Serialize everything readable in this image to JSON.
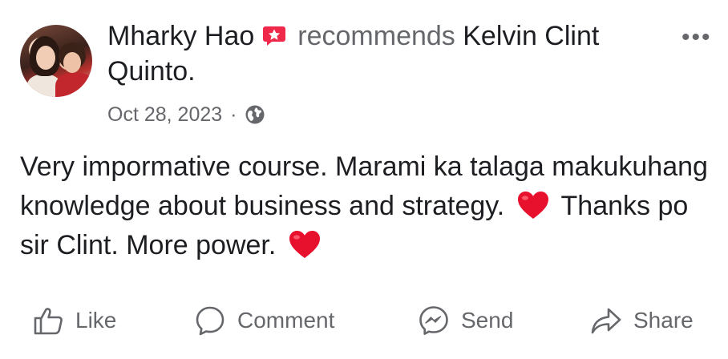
{
  "post": {
    "author": "Mharky Hao",
    "verb": "recommends",
    "target": "Kelvin Clint Quinto.",
    "date": "Oct 28, 2023",
    "separator": "·",
    "privacy_icon": "globe-icon",
    "recommend_badge_icon": "recommend-badge-icon",
    "more_label": "•••",
    "body": {
      "line_part1": "Very impormative course. Marami ka talaga makukuhang knowledge about business and strategy.",
      "line_part2": "Thanks po sir Clint. More power."
    }
  },
  "actions": [
    {
      "label": "Like",
      "icon": "like-icon"
    },
    {
      "label": "Comment",
      "icon": "comment-icon"
    },
    {
      "label": "Send",
      "icon": "messenger-icon"
    },
    {
      "label": "Share",
      "icon": "share-icon"
    }
  ],
  "colors": {
    "text": "#1c1e21",
    "secondary": "#65676b",
    "badge": "#f02849",
    "heart": "#e8112d"
  }
}
